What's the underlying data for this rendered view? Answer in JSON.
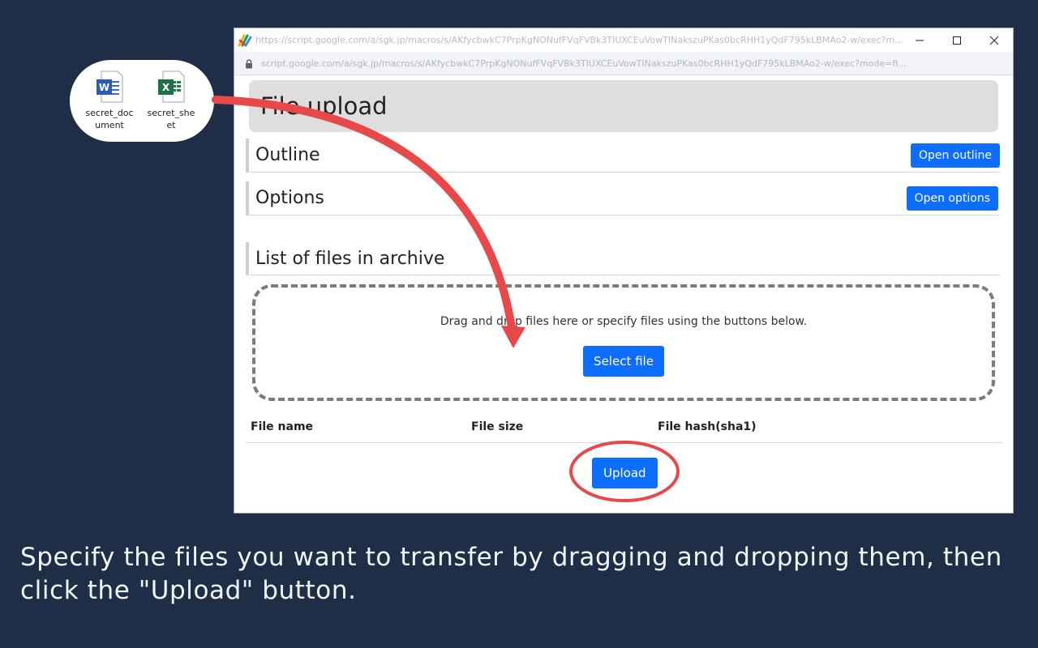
{
  "desktop_files": [
    {
      "name": "secret_document",
      "icon": "word-document-icon"
    },
    {
      "name": "secret_sheet",
      "icon": "excel-sheet-icon"
    }
  ],
  "window": {
    "title_url": "https://script.google.com/a/sgk.jp/macros/s/AKfycbwkC7PrpKgNONufFVqFVBk3TIUXCEuVowTINakszuPKas0bcRHH1yQdF795kLBMAo2-w/exec?mod...",
    "address_url": "script.google.com/a/sgk.jp/macros/s/AKfycbwkC7PrpKgNONufFVqFVBk3TIUXCEuVowTINakszuPKas0bcRHH1yQdF795kLBMAo2-w/exec?mode=fi..."
  },
  "page": {
    "title": "File upload",
    "sections": {
      "outline": {
        "heading": "Outline",
        "button": "Open outline"
      },
      "options": {
        "heading": "Options",
        "button": "Open options"
      },
      "list": {
        "heading": "List of files in archive"
      }
    },
    "dropzone": {
      "text": "Drag and drop files here or specify files using the buttons below.",
      "button": "Select file"
    },
    "table": {
      "columns": [
        "File name",
        "File size",
        "File hash(sha1)"
      ]
    },
    "upload_button": "Upload"
  },
  "caption": "Specify the files you want to transfer by dragging and dropping them, then click the \"Upload\" button.",
  "colors": {
    "background": "#1f2e47",
    "primary_button": "#0d6efd",
    "annotation": "#e8484a"
  }
}
